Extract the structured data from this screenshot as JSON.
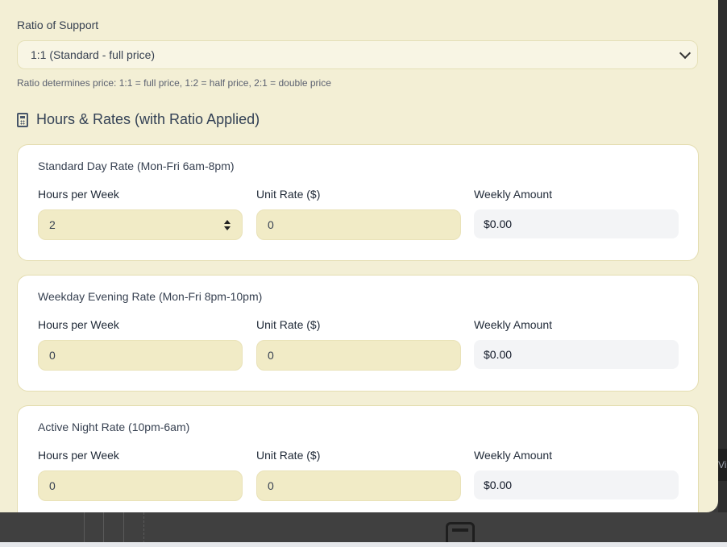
{
  "ratio": {
    "label": "Ratio of Support",
    "selected": "1:1 (Standard - full price)",
    "hint": "Ratio determines price: 1:1 = full price, 1:2 = half price, 2:1 = double price"
  },
  "section": {
    "title": "Hours & Rates (with Ratio Applied)",
    "icon": "calculator-icon"
  },
  "columns": {
    "hours": "Hours per Week",
    "rate": "Unit Rate ($)",
    "amount": "Weekly Amount"
  },
  "rates": [
    {
      "title": "Standard Day Rate (Mon-Fri 6am-8pm)",
      "hours": "2",
      "unit_rate": "0",
      "weekly_amount": "$0.00"
    },
    {
      "title": "Weekday Evening Rate (Mon-Fri 8pm-10pm)",
      "hours": "0",
      "unit_rate": "0",
      "weekly_amount": "$0.00"
    },
    {
      "title": "Active Night Rate (10pm-6am)",
      "hours": "0",
      "unit_rate": "0",
      "weekly_amount": "$0.00"
    }
  ],
  "background": {
    "right_tab_text": "Vi"
  }
}
